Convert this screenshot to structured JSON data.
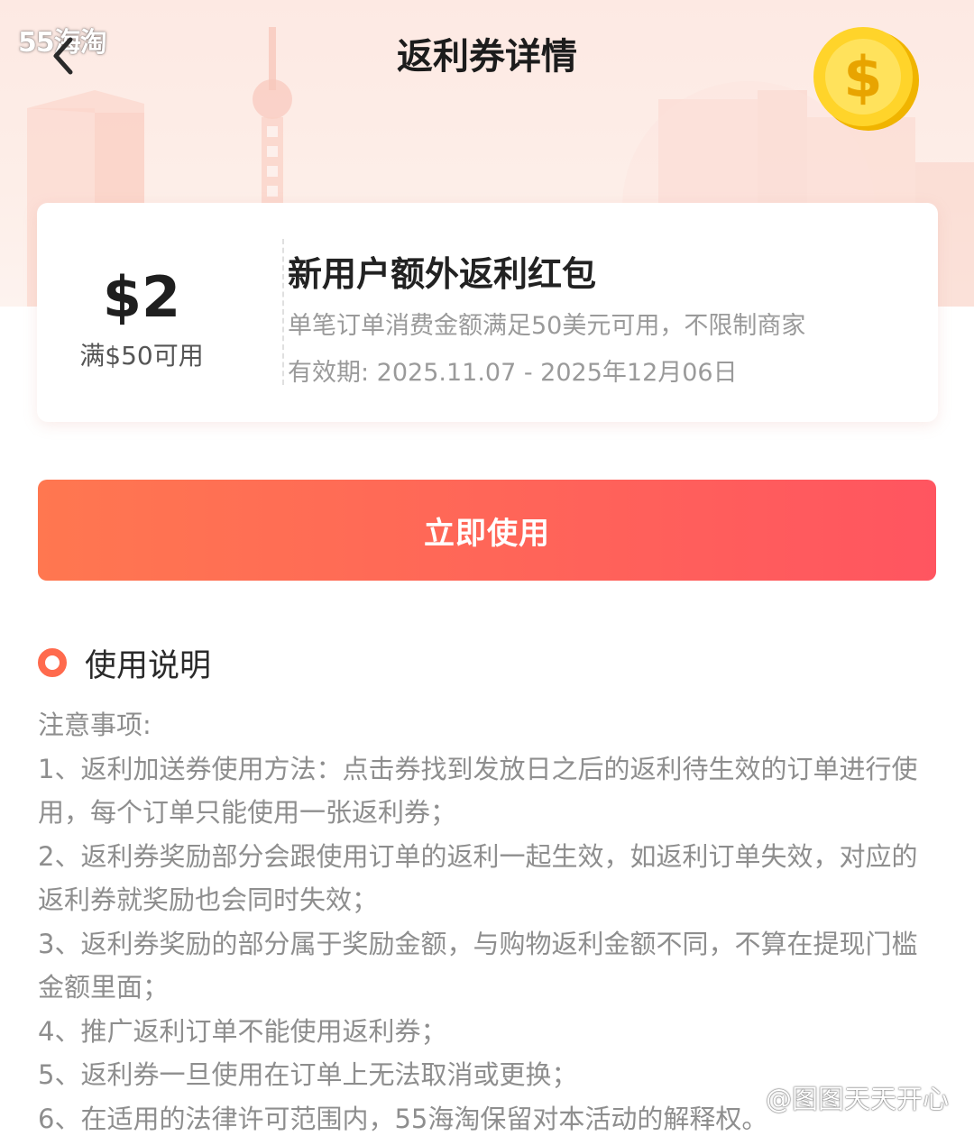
{
  "watermark": {
    "logo_text": "55海淘",
    "user_text": "@图图天天开心"
  },
  "header": {
    "title": "返利券详情",
    "back_icon": "chevron-left-icon"
  },
  "coupon": {
    "amount": "$2",
    "threshold": "满$50可用",
    "name": "新用户额外返利红包",
    "condition": "单笔订单消费金额满足50美元可用，不限制商家",
    "validity": "有效期: 2025.11.07 - 2025年12月06日"
  },
  "action": {
    "use_now_label": "立即使用"
  },
  "instructions": {
    "title": "使用说明",
    "notice_label": "注意事项:",
    "items": [
      "1、返利加送券使用方法：点击券找到发放日之后的返利待生效的订单进行使用，每个订单只能使用一张返利券；",
      "2、返利券奖励部分会跟使用订单的返利一起生效，如返利订单失效，对应的返利券就奖励也会同时失效；",
      "3、返利券奖励的部分属于奖励金额，与购物返利金额不同，不算在提现门槛金额里面；",
      "4、推广返利订单不能使用返利券；",
      "5、返利券一旦使用在订单上无法取消或更换；",
      "6、在适用的法律许可范围内，55海淘保留对本活动的解释权。"
    ]
  },
  "colors": {
    "accent": "#ff6a4d",
    "button_start": "#ff7750",
    "button_end": "#ff5560",
    "hero_bg": "#fde9e3",
    "muted_text": "#8e8e8e"
  }
}
